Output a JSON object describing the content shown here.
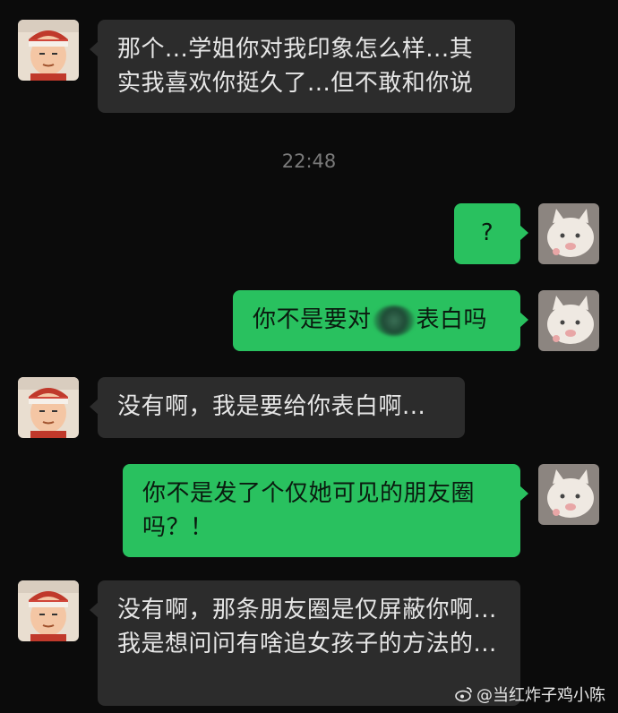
{
  "chat": {
    "messages": [
      {
        "side": "in",
        "text": "那个...学姐你对我印象怎么样...其实我喜欢你挺久了...但不敢和你说"
      },
      {
        "side": "out",
        "text": "?"
      },
      {
        "side": "out",
        "text_before": "你不是要对",
        "text_after": "表白吗"
      },
      {
        "side": "in",
        "text": "没有啊，我是要给你表白啊..."
      },
      {
        "side": "out",
        "text": "你不是发了个仅她可见的朋友圈吗？！"
      },
      {
        "side": "in",
        "text": "没有啊，那条朋友圈是仅屏蔽你啊...我是想问问有啥追女孩子的方法的..."
      }
    ],
    "timestamp": "22:48"
  },
  "watermark": {
    "text": "@当红炸子鸡小陈"
  },
  "colors": {
    "background": "#0b0b0b",
    "incoming_bubble": "#2c2c2c",
    "outgoing_bubble": "#29c15f",
    "timestamp": "#7a7a7a"
  },
  "icons": {
    "incoming_avatar": "cartoon-boy-headband-avatar",
    "outgoing_avatar": "white-cat-plush-avatar",
    "watermark_logo": "weibo-logo-icon"
  }
}
